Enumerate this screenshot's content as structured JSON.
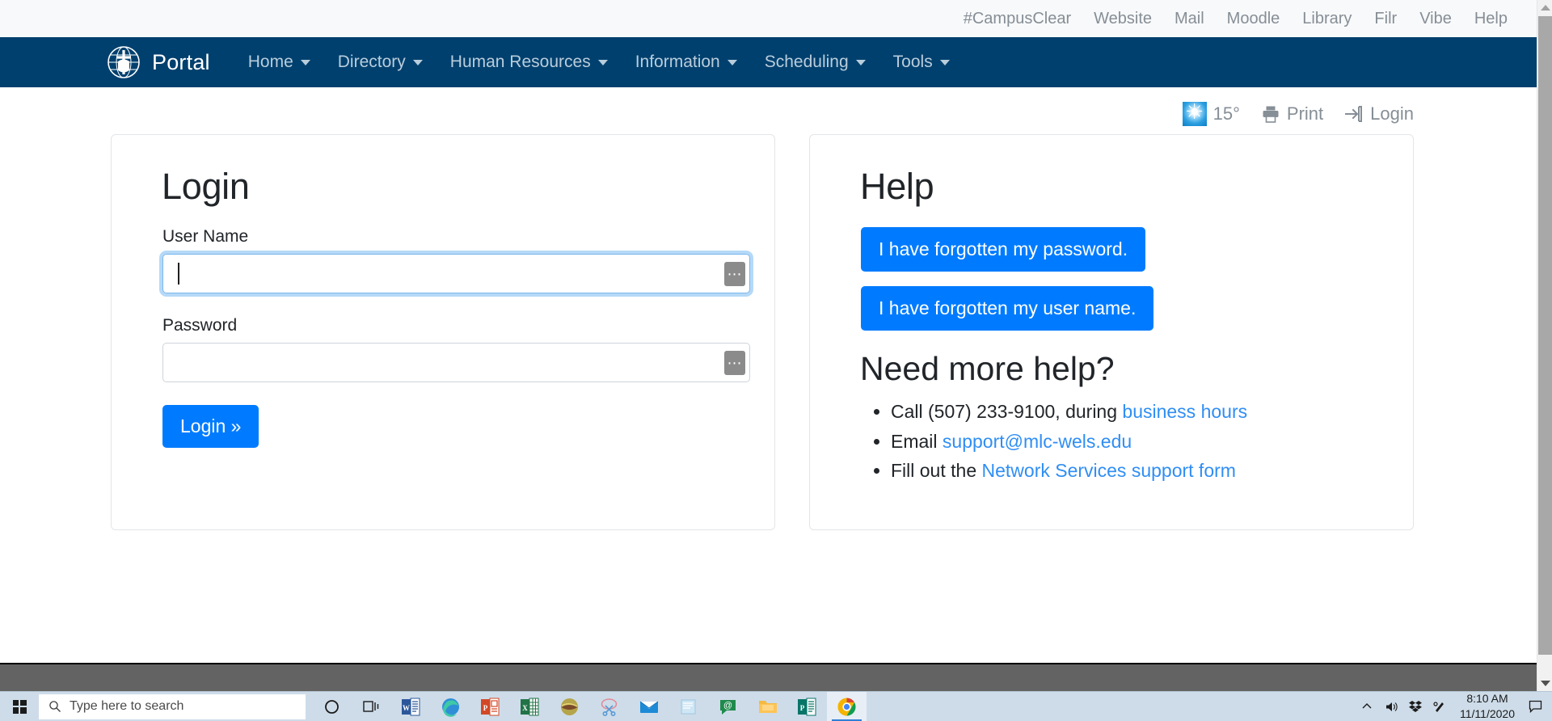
{
  "utility_bar": {
    "links": [
      {
        "label": "#CampusClear"
      },
      {
        "label": "Website"
      },
      {
        "label": "Mail"
      },
      {
        "label": "Moodle"
      },
      {
        "label": "Library"
      },
      {
        "label": "Filr"
      },
      {
        "label": "Vibe"
      },
      {
        "label": "Help"
      }
    ]
  },
  "navbar": {
    "brand": "Portal",
    "brand_logo_icon": "globe-cross-emblem-icon",
    "background_color": "#00406e",
    "items": [
      {
        "label": "Home",
        "has_caret": true
      },
      {
        "label": "Directory",
        "has_caret": true
      },
      {
        "label": "Human Resources",
        "has_caret": true
      },
      {
        "label": "Information",
        "has_caret": true
      },
      {
        "label": "Scheduling",
        "has_caret": true
      },
      {
        "label": "Tools",
        "has_caret": true
      }
    ]
  },
  "toolbar": {
    "weather_icon": "sun-weather-icon",
    "temperature": "15°",
    "print_icon": "printer-icon",
    "print_label": "Print",
    "login_icon": "sign-in-arrow-icon",
    "login_label": "Login"
  },
  "login_card": {
    "title": "Login",
    "username_label": "User Name",
    "username_value": "",
    "username_placeholder": "",
    "username_autofill_icon": "ellipsis-autofill-icon",
    "password_label": "Password",
    "password_value": "",
    "password_placeholder": "",
    "password_autofill_icon": "ellipsis-autofill-icon",
    "submit_label": "Login »",
    "accent_color": "#007bff"
  },
  "help_card": {
    "title": "Help",
    "buttons": [
      {
        "label": "I have forgotten my password."
      },
      {
        "label": "I have forgotten my user name."
      }
    ],
    "subtitle": "Need more help?",
    "items": [
      {
        "pre": "Call (507) 233-9100, during ",
        "link": "business hours",
        "post": ""
      },
      {
        "pre": "Email ",
        "link": "support@mlc-wels.edu",
        "post": ""
      },
      {
        "pre": "Fill out the ",
        "link": "Network Services support form",
        "post": ""
      }
    ],
    "link_color": "#2f8ef4"
  },
  "taskbar": {
    "start_icon": "windows-start-icon",
    "search_icon": "search-icon",
    "search_placeholder": "Type here to search",
    "search_value": "",
    "icons": [
      {
        "name": "cortana-icon",
        "glyph": "◯"
      },
      {
        "name": "task-view-icon",
        "glyph": "⌸"
      },
      {
        "name": "word-icon",
        "letter": "W",
        "color": "#2b579a"
      },
      {
        "name": "edge-icon",
        "glyph": ""
      },
      {
        "name": "powerpoint-icon",
        "letter": "P",
        "color": "#d24726"
      },
      {
        "name": "excel-icon",
        "letter": "X",
        "color": "#217346"
      },
      {
        "name": "olive-app-icon",
        "glyph": ""
      },
      {
        "name": "snipping-tool-icon",
        "glyph": "✂"
      },
      {
        "name": "mail-icon",
        "glyph": "✉"
      },
      {
        "name": "sticky-notes-icon",
        "glyph": "▧"
      },
      {
        "name": "groupwise-icon",
        "glyph": "@"
      },
      {
        "name": "file-explorer-icon",
        "glyph": ""
      },
      {
        "name": "publisher-icon",
        "letter": "P",
        "color": "#077568"
      },
      {
        "name": "chrome-icon",
        "glyph": "",
        "active": true
      }
    ],
    "tray": [
      {
        "name": "show-hidden-icons-icon",
        "glyph": "∧"
      },
      {
        "name": "volume-icon",
        "glyph": "🔊"
      },
      {
        "name": "dropbox-icon",
        "glyph": ""
      },
      {
        "name": "network-pen-icon",
        "glyph": "✐"
      }
    ],
    "clock_time": "8:10 AM",
    "clock_date": "11/11/2020",
    "notification_icon": "notification-center-icon"
  },
  "scrollbar": {
    "up_arrow_icon": "scroll-up-arrow-icon",
    "down_arrow_icon": "scroll-down-arrow-icon"
  }
}
